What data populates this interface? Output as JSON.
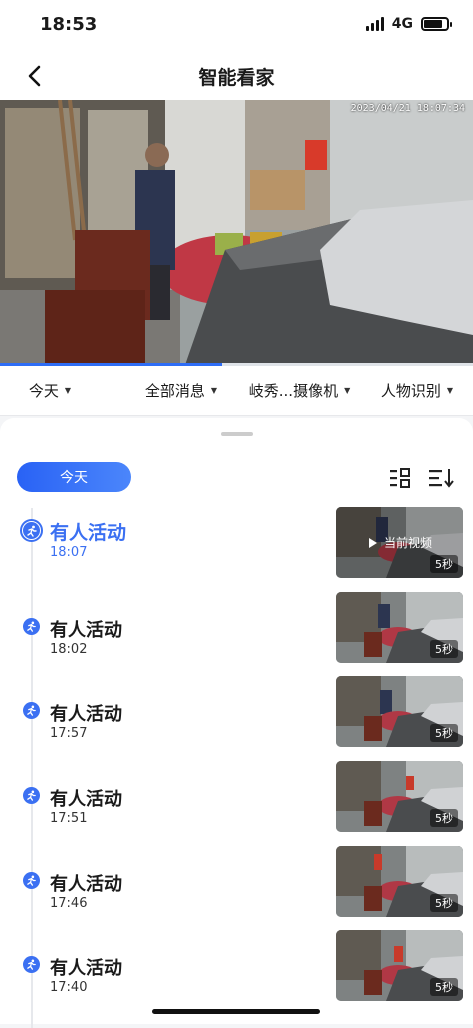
{
  "status_bar": {
    "time": "18:53",
    "network": "4G",
    "battery_level": 0.8
  },
  "nav": {
    "title": "智能看家"
  },
  "video": {
    "timestamp": "2023/04/21 18:07:34",
    "playback_progress": 0.47
  },
  "filters": [
    {
      "label": "今天"
    },
    {
      "label": "全部消息"
    },
    {
      "label": "岐秀...摄像机"
    },
    {
      "label": "人物识别"
    }
  ],
  "timeline": {
    "date_pill": "今天",
    "events": [
      {
        "title": "有人活动",
        "time": "18:07",
        "thumb_label": "当前视频",
        "duration": "5秒"
      },
      {
        "title": "有人活动",
        "time": "18:02",
        "duration": "5秒"
      },
      {
        "title": "有人活动",
        "time": "17:57",
        "duration": "5秒"
      },
      {
        "title": "有人活动",
        "time": "17:51",
        "duration": "5秒"
      },
      {
        "title": "有人活动",
        "time": "17:46",
        "duration": "5秒"
      },
      {
        "title": "有人活动",
        "time": "17:40",
        "duration": "5秒"
      }
    ]
  },
  "colors": {
    "accent": "#3b70f2",
    "pill_start": "#2962f5",
    "pill_end": "#4b86fb"
  },
  "icons": [
    "back-arrow-icon",
    "signal-icon",
    "battery-icon",
    "caret-down-icon",
    "grid-filter-icon",
    "sort-icon",
    "person-running-icon",
    "play-icon"
  ]
}
